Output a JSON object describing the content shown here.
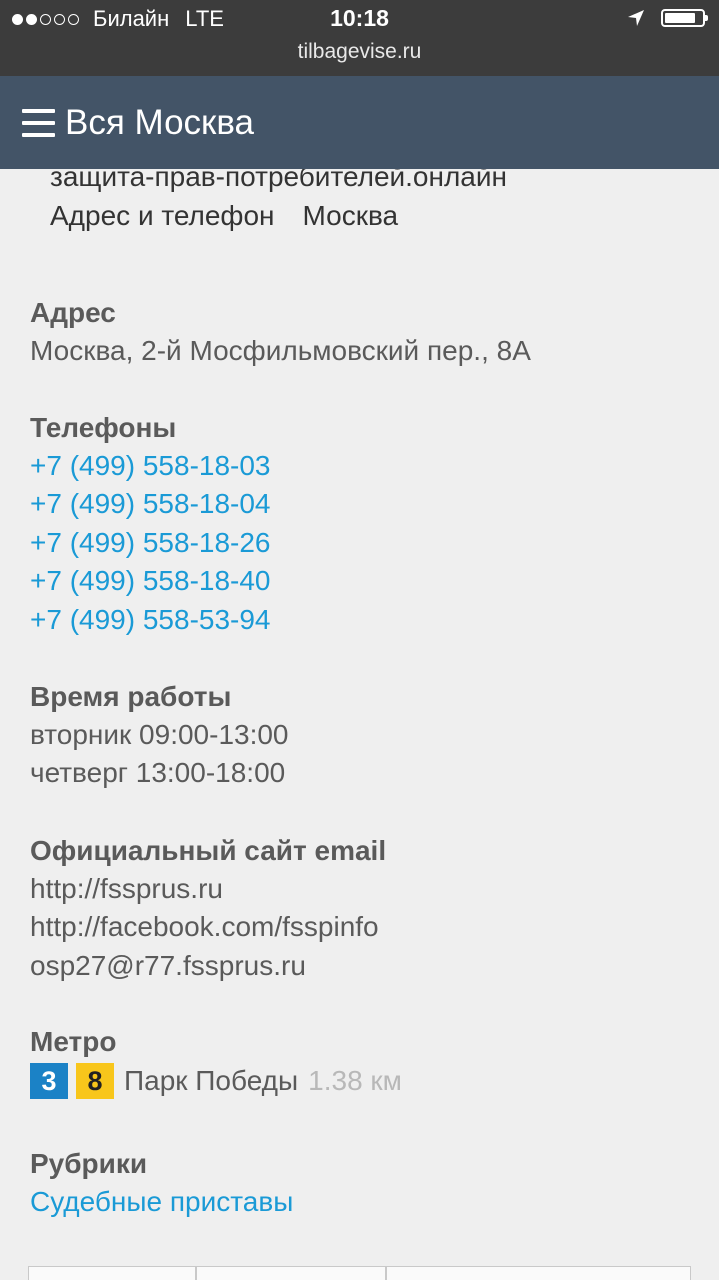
{
  "statusbar": {
    "carrier": "Билайн",
    "network": "LTE",
    "time": "10:18",
    "url": "tilbagevise.ru",
    "signal_dots_filled": 2,
    "signal_dots_total": 5,
    "battery_level": 0.8
  },
  "header": {
    "title": "Вся Москва"
  },
  "breadcrumb": {
    "line1": "защита-прав-потребителей.онлайн",
    "item1": "Адрес и телефон",
    "item2": "Москва"
  },
  "address": {
    "heading": "Адрес",
    "value": "Москва, 2-й Мосфильмовский пер., 8А"
  },
  "phones": {
    "heading": "Телефоны",
    "items": [
      "+7 (499) 558-18-03",
      "+7 (499) 558-18-04",
      "+7 (499) 558-18-26",
      "+7 (499) 558-18-40",
      "+7 (499) 558-53-94"
    ]
  },
  "hours": {
    "heading": "Время работы",
    "items": [
      "вторник 09:00-13:00",
      "четверг 13:00-18:00"
    ]
  },
  "site": {
    "heading": "Официальный сайт email",
    "items": [
      "http://fssprus.ru",
      "http://facebook.com/fsspinfo",
      "osp27@r77.fssprus.ru"
    ]
  },
  "metro": {
    "heading": "Метро",
    "line_a": "3",
    "line_b": "8",
    "station": "Парк Победы",
    "distance": "1.38 км"
  },
  "rubrics": {
    "heading": "Рубрики",
    "item": "Судебные приставы"
  },
  "colors": {
    "header_bg": "#435467",
    "link": "#1a9ad6",
    "metro_3": "#1b82c6",
    "metro_8": "#f8c61b"
  }
}
